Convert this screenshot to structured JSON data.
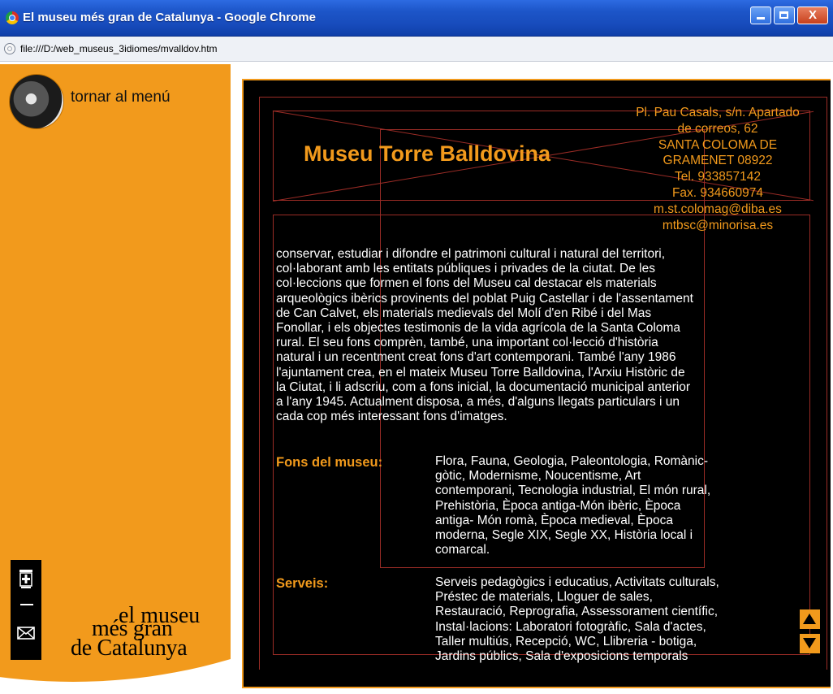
{
  "window": {
    "title": "El museu més gran de Catalunya - Google Chrome",
    "close_glyph": "X",
    "url": "file:///D:/web_museus_3idiomes/mvalldov.htm"
  },
  "sidebar": {
    "back_link": "tornar al menú",
    "icons": [
      "shield-icon",
      "mail-icon"
    ],
    "logo": {
      "bracket": "[•]",
      "line1": "el museu",
      "line2": "més gran",
      "line3": "de Catalunya"
    }
  },
  "museum": {
    "title": "Museu Torre Balldovina",
    "address_lines": [
      "Pl. Pau Casals, s/n. Apartado",
      "de correos, 62",
      "SANTA COLOMA DE",
      "GRAMENET 08922",
      "Tel. 933857142",
      "Fax. 934660974",
      "m.st.colomag@diba.es",
      "mtbsc@minorisa.es"
    ],
    "description_lines": [
      "conservar, estudiar i difondre el patrimoni cultural i natural del territori,",
      "col·laborant amb les entitats públiques i privades de la ciutat. De les",
      "col·leccions que formen el fons del Museu cal destacar els materials",
      "arqueològics ibèrics provinents del poblat Puig Castellar i de l'assentament",
      "de Can Calvet, els materials medievals del Molí d'en Ribé i del Mas",
      "Fonollar, i els objectes testimonis de la vida agrícola de la Santa Coloma",
      "rural. El seu fons comprèn, també, una important col·lecció d'història",
      "natural i un recentment creat fons d'art contemporani. També l'any 1986",
      "l'ajuntament crea, en el mateix Museu Torre Balldovina, l'Arxiu Històric de",
      "la Ciutat, i li adscriu, com a fons inicial, la documentació municipal anterior",
      "a l'any 1945. Actualment disposa, a més, d'alguns llegats particulars i un",
      "cada cop més interessant fons d'imatges."
    ],
    "fons": {
      "label": "Fons del museu:",
      "lines": [
        "Flora, Fauna, Geologia, Paleontologia, Romànic-",
        "gòtic, Modernisme, Noucentisme, Art",
        "contemporani, Tecnologia industrial, El món rural,",
        "Prehistòria, Època antiga-Món ibèric, Època",
        "antiga- Món romà, Època medieval, Època",
        "moderna, Segle XIX, Segle XX, Història local i",
        "comarcal."
      ]
    },
    "serveis": {
      "label": "Serveis:",
      "lines": [
        "Serveis pedagògics i educatius, Activitats culturals,",
        "Préstec de materials, Lloguer de sales,",
        "Restauració, Reprografia, Assessorament científic,",
        "Instal·lacions: Laboratori fotogràfic, Sala d'actes,",
        "Taller multiús, Recepció, WC, Llibreria - botiga,",
        "Jardins públics, Sala d'exposicions temporals"
      ]
    }
  },
  "colors": {
    "accent": "#f29a1c",
    "guide": "#9b2c26",
    "content_bg": "#000000"
  }
}
